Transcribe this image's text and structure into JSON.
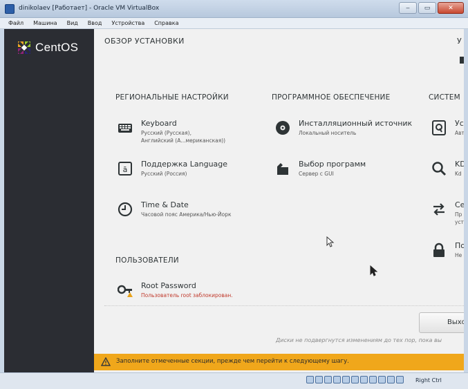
{
  "window": {
    "title": "dinikolaev [Работает] - Oracle VM VirtualBox",
    "minimize": "‒",
    "restore": "▭",
    "close": "✕"
  },
  "menu": [
    "Файл",
    "Машина",
    "Вид",
    "Ввод",
    "Устройства",
    "Справка"
  ],
  "sidebar": {
    "logo_text": "CentOS"
  },
  "main": {
    "title": "ОБЗОР УСТАНОВКИ",
    "cut_right_title": "У",
    "sections": {
      "regional": "РЕГИОНАЛЬНЫЕ НАСТРОЙКИ",
      "software": "ПРОГРАММНОЕ ОБЕСПЕЧЕНИЕ",
      "system": "СИСТЕМ",
      "users": "ПОЛЬЗОВАТЕЛИ"
    },
    "spokes": {
      "keyboard": {
        "title": "Keyboard",
        "line1": "Русский (Русская),",
        "line2": "Английский (А...мериканская))"
      },
      "language": {
        "title": "Поддержка Language",
        "status": "Русский (Россия)"
      },
      "datetime": {
        "title": "Time & Date",
        "status": "Часовой пояс Америка/Нью-Йорк"
      },
      "source": {
        "title": "Инсталляционный источник",
        "status": "Локальный носитель"
      },
      "software": {
        "title": "Выбор программ",
        "status": "Сервер с GUI"
      },
      "root": {
        "title": "Root Password",
        "status": "Пользователь root заблокирован."
      },
      "sys_dest": {
        "title": "Ус",
        "status": "Авт"
      },
      "sys_kdump": {
        "title": "KD",
        "status": "Kd"
      },
      "sys_network": {
        "title": "Се",
        "line1": "Пр",
        "line2": "уст"
      },
      "sys_security": {
        "title": "По",
        "status": "Не"
      }
    },
    "exit_button": "Выход",
    "notice": "Диски не подвергнутся изменениям до тех пор, пока вы"
  },
  "warning_bar": {
    "message": "Заполните отмеченные секции, прежде чем перейти к следующему шагу."
  },
  "statusbar": {
    "host_key": "Right Ctrl"
  },
  "colors": {
    "sidebar": "#2b2d33",
    "content": "#f1f1f1",
    "warning": "#f0a71b",
    "error_text": "#c0392b"
  }
}
